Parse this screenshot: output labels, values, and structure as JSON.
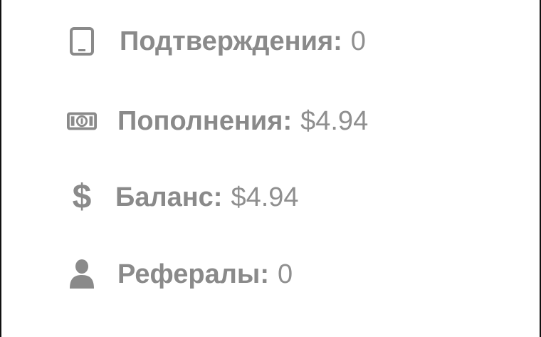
{
  "stats": {
    "confirmations": {
      "label": "Подтверждения:",
      "value": "0",
      "icon": "tablet-icon"
    },
    "deposits": {
      "label": "Пополнения:",
      "value": "$4.94",
      "icon": "banknote-icon"
    },
    "balance": {
      "label": "Баланс:",
      "value": "$4.94",
      "icon": "dollar-icon"
    },
    "referrals": {
      "label": "Рефералы:",
      "value": "0",
      "icon": "user-icon"
    }
  },
  "colors": {
    "text": "#8a8a8a",
    "background": "#ffffff",
    "border": "#111111"
  }
}
